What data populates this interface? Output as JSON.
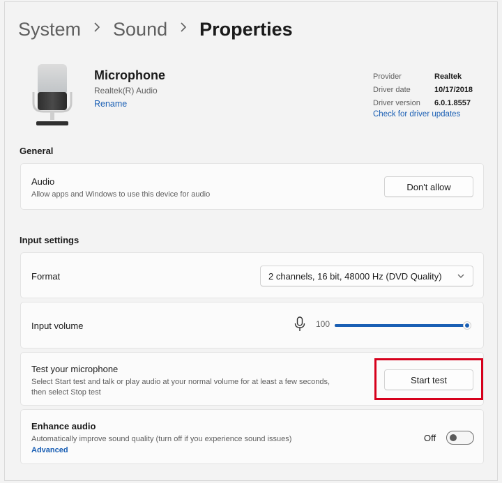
{
  "breadcrumb": {
    "items": [
      "System",
      "Sound"
    ],
    "current": "Properties"
  },
  "device": {
    "name": "Microphone",
    "driver_name": "Realtek(R) Audio",
    "rename_label": "Rename",
    "meta": [
      {
        "key": "Provider",
        "value": "Realtek"
      },
      {
        "key": "Driver date",
        "value": "10/17/2018"
      },
      {
        "key": "Driver version",
        "value": "6.0.1.8557"
      }
    ],
    "check_updates_label": "Check for driver updates"
  },
  "general": {
    "title": "General",
    "audio": {
      "title": "Audio",
      "description": "Allow apps and Windows to use this device for audio",
      "button_label": "Don't allow"
    }
  },
  "input_settings": {
    "title": "Input settings",
    "format": {
      "title": "Format",
      "selected": "2 channels, 16 bit, 48000 Hz (DVD Quality)"
    },
    "input_volume": {
      "title": "Input volume",
      "value": "100",
      "level": 1.0
    },
    "test": {
      "title": "Test your microphone",
      "description_line1": "Select Start test and talk or play audio at your normal volume for at least a few seconds,",
      "description_line2": "then select Stop test",
      "button_label": "Start test"
    },
    "enhance": {
      "title": "Enhance audio",
      "description": "Automatically improve sound quality (turn off if you experience sound issues)",
      "advanced_label": "Advanced",
      "toggle_state_label": "Off",
      "toggle_on": false
    }
  },
  "colors": {
    "accent": "#1a5fb4",
    "highlight": "#d6001c"
  },
  "icons": {
    "breadcrumb_separator": "chevron-right-icon",
    "format_dropdown": "chevron-down-icon",
    "volume": "microphone-icon",
    "device": "microphone-device-icon"
  }
}
